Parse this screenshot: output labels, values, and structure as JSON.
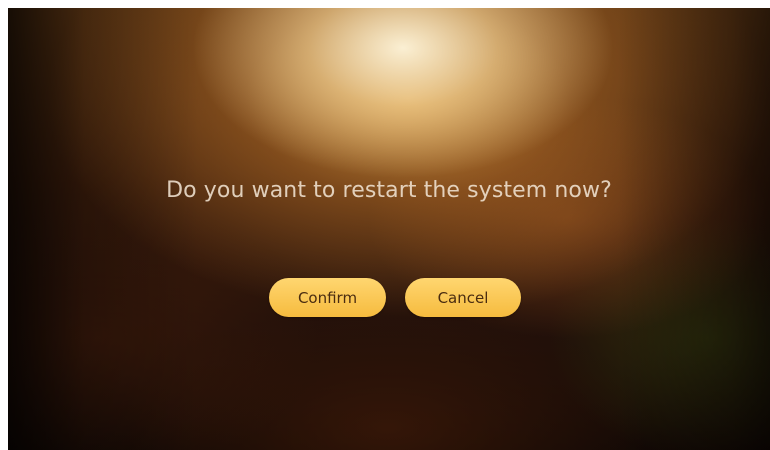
{
  "dialog": {
    "message": "Do you want to restart the system now?",
    "confirm_label": "Confirm",
    "cancel_label": "Cancel"
  },
  "colors": {
    "button_fill": "#f9c451",
    "button_text": "#4a2c10",
    "message_text": "#f0e2d2"
  }
}
